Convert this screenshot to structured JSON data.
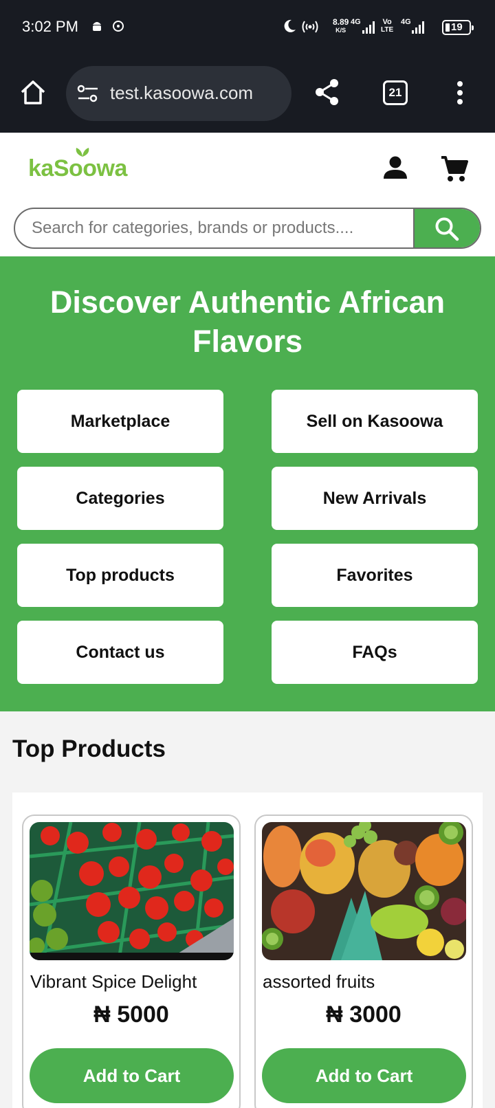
{
  "status_bar": {
    "time": "3:02 PM",
    "speed_value": "8.89",
    "speed_unit": "K/S",
    "net1": "4G",
    "net2_top": "Vo",
    "net2_bottom": "LTE",
    "net3": "4G",
    "battery": "19"
  },
  "browser": {
    "url": "test.kasoowa.com",
    "tab_count": "21"
  },
  "site": {
    "logo_pre": "kaS",
    "logo_oo": "oo",
    "logo_post": "wa",
    "search_placeholder": "Search for categories, brands or products....",
    "brand_color": "#4caf50"
  },
  "hero": {
    "title": "Discover Authentic African Flavors",
    "buttons": [
      "Marketplace",
      "Sell on Kasoowa",
      "Categories",
      "New Arrivals",
      "Top products",
      "Favorites",
      "Contact us",
      "FAQs"
    ]
  },
  "top_products": {
    "title": "Top Products",
    "items": [
      {
        "name": "Vibrant Spice Delight",
        "currency": "₦",
        "price": "5000",
        "button": "Add to Cart",
        "image": "red-peppers-in-crates"
      },
      {
        "name": "assorted fruits",
        "currency": "₦",
        "price": "3000",
        "button": "Add to Cart",
        "image": "assorted-tropical-fruits"
      }
    ]
  }
}
